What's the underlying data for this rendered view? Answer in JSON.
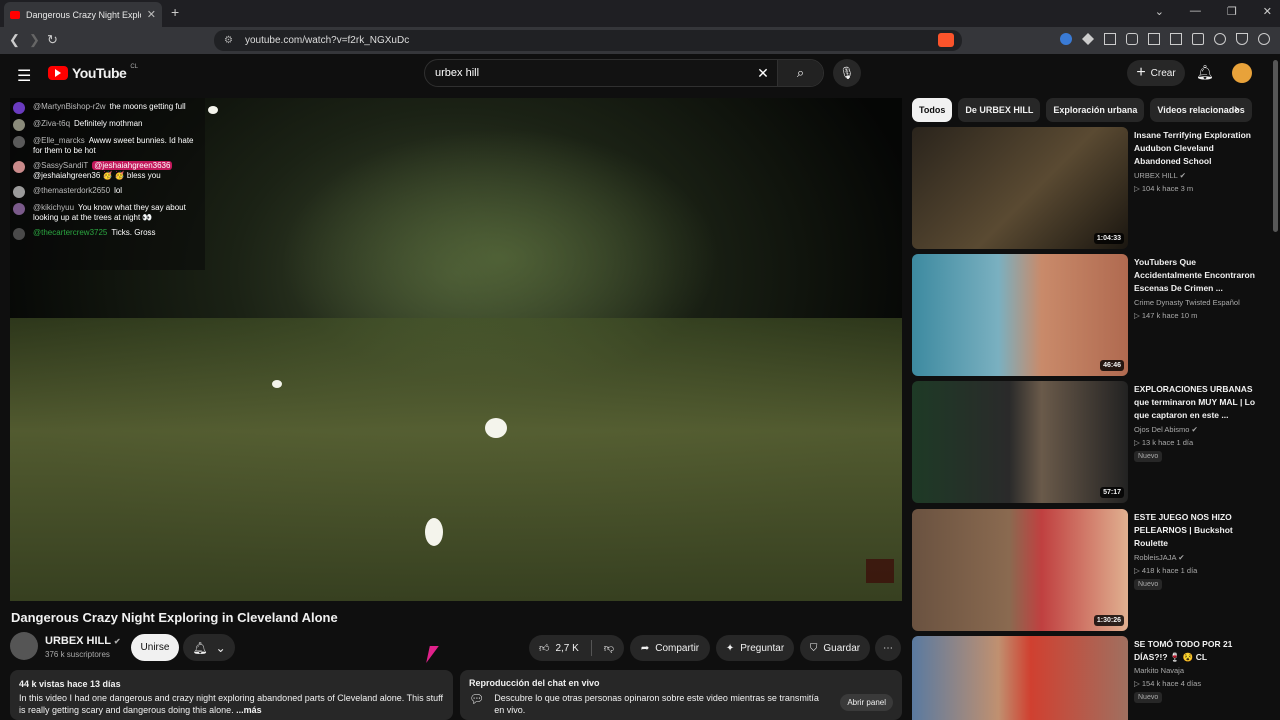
{
  "browser": {
    "tab_title": "Dangerous Crazy Night Explo",
    "url": "youtube.com/watch?v=f2rk_NGXuDc"
  },
  "header": {
    "logo_text": "YouTube",
    "country_code": "CL",
    "search_query": "urbex hill",
    "create_label": "Crear"
  },
  "chat_overlay": [
    {
      "user": "@MartynBishop-r2w",
      "text": "the moons getting full",
      "avatar_color": "#6a3bbf"
    },
    {
      "user": "@Ziva-t6q",
      "text": "Definitely mothman",
      "avatar_color": "#8a8a7a"
    },
    {
      "user": "@Elle_marcks",
      "text": "Awww sweet bunnies. Id hate for them to be hot",
      "avatar_color": "#5a5a5a"
    },
    {
      "user": "@SassySandiT",
      "text": "@jeshaiahgreen36 🥳 🥳 bless you",
      "avatar_color": "#c98a8a",
      "mention": "@jeshaiahgreen3636"
    },
    {
      "user": "@themasterdork2650",
      "text": "lol",
      "avatar_color": "#9a9a9a"
    },
    {
      "user": "@kikichyuu",
      "text": "You know what they say about looking up at the trees at night 👀",
      "avatar_color": "#7a5a8a"
    },
    {
      "user": "@thecartercrew3725",
      "text": "Ticks. Gross",
      "avatar_color": "#4a4a4a"
    }
  ],
  "video": {
    "title": "Dangerous Crazy Night Exploring in Cleveland Alone",
    "channel": "URBEX HILL",
    "subscribers": "376 k suscriptores",
    "join_label": "Unirse",
    "likes": "2,7 K",
    "share_label": "Compartir",
    "ask_label": "Preguntar",
    "save_label": "Guardar"
  },
  "description": {
    "stats": "44 k vistas  hace 13 días",
    "text": "In this video I had one dangerous and crazy night exploring abandoned parts of Cleveland alone. This stuff is really getting scary and dangerous doing this alone.",
    "more_label": "...más"
  },
  "live_chat_replay": {
    "heading": "Reproducción del chat en vivo",
    "text": "Descubre lo que otras personas opinaron sobre este video mientras se transmitía en vivo.",
    "button": "Abrir panel"
  },
  "chips": [
    "Todos",
    "De URBEX HILL",
    "Exploración urbana",
    "Videos relacionados"
  ],
  "recommendations": [
    {
      "title": "Insane Terrifying Exploration Audubon Cleveland Abandoned School",
      "channel": "URBEX HILL",
      "verified": true,
      "meta": "104 k  hace 3 m",
      "duration": "1:04:33",
      "badge": "",
      "thumb": "#3a3228"
    },
    {
      "title": "YouTubers Que Accidentalmente Encontraron Escenas De Crimen ...",
      "channel": "Crime Dynasty Twisted Español",
      "verified": false,
      "meta": "147 k  hace 10 m",
      "duration": "46:46",
      "badge": "",
      "thumb": "#4a7b8a"
    },
    {
      "title": "EXPLORACIONES URBANAS que terminaron MUY MAL | Lo que captaron en este ...",
      "channel": "Ojos Del Abismo",
      "verified": true,
      "meta": "13 k  hace 1 día",
      "duration": "57:17",
      "badge": "Nuevo",
      "thumb": "#2e3a2a"
    },
    {
      "title": "ESTE JUEGO NOS HIZO PELEARNOS | Buckshot Roulette",
      "channel": "RobleisJAJA",
      "verified": true,
      "meta": "418 k  hace 1 día",
      "duration": "1:30:26",
      "badge": "Nuevo",
      "thumb": "#5a4a3a"
    },
    {
      "title": "SE TOMÓ TODO POR 21 DÍAS?!? 🍷 😵 CL",
      "channel": "Markito Navaja",
      "verified": false,
      "meta": "154 k  hace 4 días",
      "duration": "",
      "badge": "Nuevo",
      "thumb": "#8a6a4a"
    }
  ]
}
